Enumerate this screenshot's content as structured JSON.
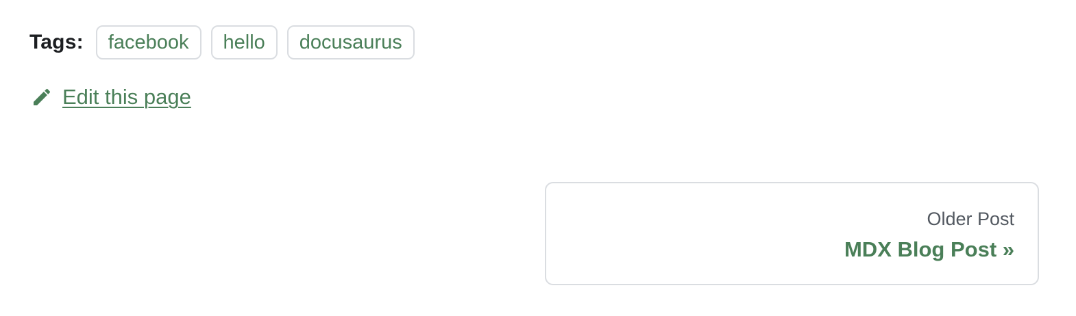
{
  "tags": {
    "label": "Tags:",
    "items": [
      {
        "label": "facebook"
      },
      {
        "label": "hello"
      },
      {
        "label": "docusaurus"
      }
    ]
  },
  "edit": {
    "icon": "pencil-icon",
    "label": "Edit this page"
  },
  "pager": {
    "sublabel": "Older Post",
    "label": "MDX Blog Post »"
  },
  "colors": {
    "accent": "#4a7f58",
    "border": "#dadde1",
    "text": "#1c1e21",
    "muted": "#525860"
  }
}
